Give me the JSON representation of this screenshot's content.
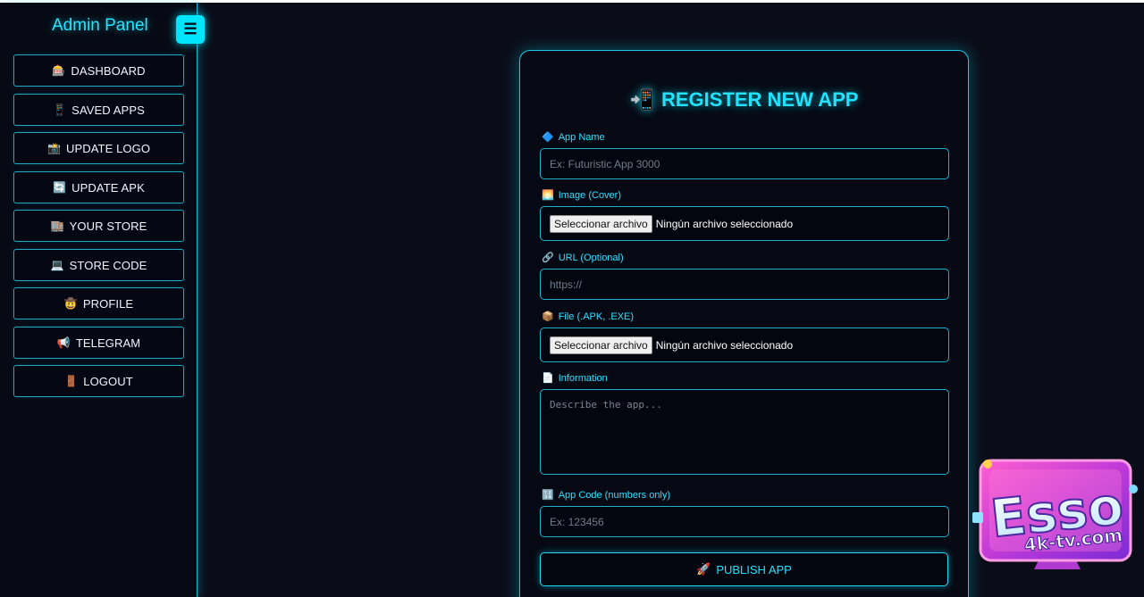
{
  "sidebar": {
    "title": "Admin Panel",
    "toggle_icon": "☰",
    "items": [
      {
        "icon": "🎰",
        "label": "DASHBOARD"
      },
      {
        "icon": "📱",
        "label": "SAVED APPS"
      },
      {
        "icon": "📸",
        "label": "UPDATE LOGO"
      },
      {
        "icon": "🔄",
        "label": "UPDATE APK"
      },
      {
        "icon": "🏬",
        "label": "YOUR STORE"
      },
      {
        "icon": "💻",
        "label": "STORE CODE"
      },
      {
        "icon": "🤠",
        "label": "PROFILE"
      },
      {
        "icon": "📢",
        "label": "TELEGRAM"
      },
      {
        "icon": "🚪",
        "label": "LOGOUT"
      }
    ]
  },
  "form": {
    "title_icon": "📲",
    "title": "REGISTER NEW APP",
    "app_name": {
      "icon": "🔷",
      "label": "App Name",
      "placeholder": "Ex: Futuristic App 3000"
    },
    "image": {
      "icon": "🌅",
      "label": "Image (Cover)",
      "button": "Seleccionar archivo",
      "status": "Ningún archivo seleccionado"
    },
    "url": {
      "icon": "🔗",
      "label": "URL (Optional)",
      "placeholder": "https://"
    },
    "file": {
      "icon": "📦",
      "label": "File (.APK, .EXE)",
      "button": "Seleccionar archivo",
      "status": "Ningún archivo seleccionado"
    },
    "information": {
      "icon": "📄",
      "label": "Information",
      "placeholder": "Describe the app..."
    },
    "app_code": {
      "icon": "🔢",
      "label": "App Code (numbers only)",
      "placeholder": "Ex: 123456"
    },
    "publish": {
      "icon": "🚀",
      "label": "PUBLISH APP"
    }
  },
  "watermark": {
    "main": "Esso",
    "sub": "4k-tv.com"
  },
  "colors": {
    "accent": "#00e5ff",
    "background": "#0a0d18",
    "border": "#1eb0cc"
  }
}
